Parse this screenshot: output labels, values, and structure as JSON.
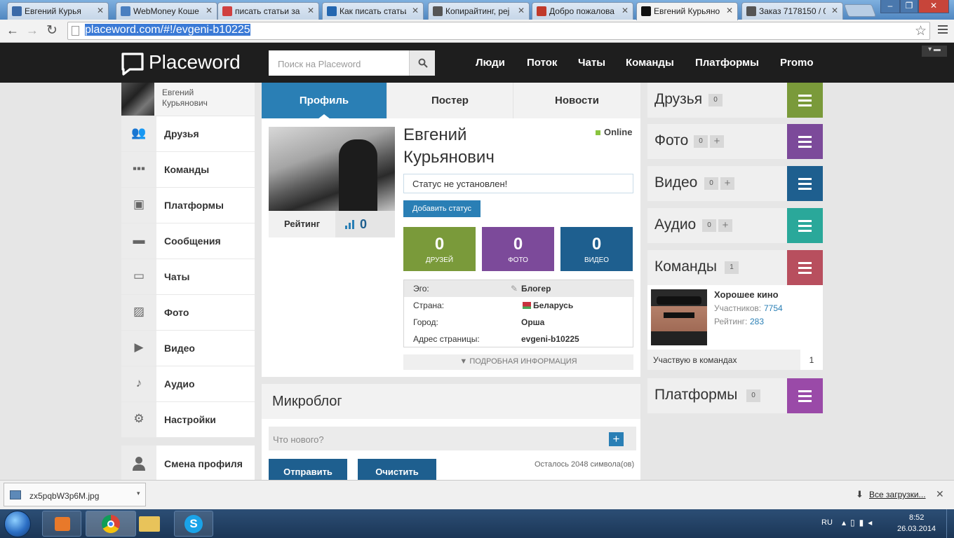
{
  "browser": {
    "tabs": [
      {
        "title": "Евгений Курья",
        "favicon": "video-favicon",
        "color": "#3b6aa8"
      },
      {
        "title": "WebMoney Коше",
        "favicon": "webmoney-favicon",
        "color": "#4a7fc0"
      },
      {
        "title": "писать статьи за д",
        "favicon": "yandex-favicon",
        "color": "#d04040"
      },
      {
        "title": "Как писать статьи",
        "favicon": "bo-favicon",
        "color": "#2366b0"
      },
      {
        "title": "Копирайтинг, реј",
        "favicon": "a-favicon",
        "color": "#555555"
      },
      {
        "title": "Добро пожалова",
        "favicon": "gmail-favicon",
        "color": "#c03a2b"
      },
      {
        "title": "Евгений Курьяно",
        "favicon": "placeword-favicon",
        "color": "#111111"
      },
      {
        "title": "Заказ 7178150 / 0",
        "favicon": "a-favicon",
        "color": "#555555"
      }
    ],
    "url_selected": "placeword.com/#!/evgeni-b10225"
  },
  "header": {
    "logo": "Placeword",
    "search_placeholder": "Поиск на Placeword",
    "nav": [
      "Люди",
      "Поток",
      "Чаты",
      "Команды",
      "Платформы",
      "Promo"
    ]
  },
  "sidebar": {
    "user_name_line1": "Евгений",
    "user_name_line2": "Курьянович",
    "items": [
      {
        "label": "Друзья",
        "icon": "friends-icon"
      },
      {
        "label": "Команды",
        "icon": "teams-icon"
      },
      {
        "label": "Платформы",
        "icon": "platforms-icon"
      },
      {
        "label": "Сообщения",
        "icon": "messages-icon"
      },
      {
        "label": "Чаты",
        "icon": "chats-icon"
      },
      {
        "label": "Фото",
        "icon": "photo-icon"
      },
      {
        "label": "Видео",
        "icon": "video-icon"
      },
      {
        "label": "Аудио",
        "icon": "audio-icon"
      },
      {
        "label": "Настройки",
        "icon": "settings-icon"
      }
    ],
    "switch_profile": "Смена профиля"
  },
  "profile": {
    "tabs": [
      "Профиль",
      "Постер",
      "Новости"
    ],
    "name_line1": "Евгений",
    "name_line2": "Курьянович",
    "online": "Online",
    "status": "Статус не установлен!",
    "add_status": "Добавить статус",
    "rating_label": "Рейтинг",
    "rating_value": "0",
    "stats": [
      {
        "value": "0",
        "label": "ДРУЗЕЙ",
        "color": "#7a9a3a"
      },
      {
        "value": "0",
        "label": "ФОТО",
        "color": "#7c4a9a"
      },
      {
        "value": "0",
        "label": "ВИДЕО",
        "color": "#1e5f8f"
      }
    ],
    "info": [
      {
        "key": "Эго:",
        "value": "Блогер"
      },
      {
        "key": "Страна:",
        "value": "Беларусь"
      },
      {
        "key": "Город:",
        "value": "Орша"
      },
      {
        "key": "Адрес страницы:",
        "value": "evgeni-b10225"
      }
    ],
    "more_info": "ПОДРОБНАЯ ИНФОРМАЦИЯ"
  },
  "microblog": {
    "title": "Микроблог",
    "placeholder": "Что нового?",
    "send": "Отправить",
    "clear": "Очистить",
    "remaining": "Осталось 2048 символа(ов)"
  },
  "right": {
    "friends": {
      "title": "Друзья",
      "count": "0",
      "color": "#7a9a3a"
    },
    "photo": {
      "title": "Фото",
      "count": "0",
      "plus": "+",
      "color": "#7c4a9a"
    },
    "video": {
      "title": "Видео",
      "count": "0",
      "plus": "+",
      "color": "#1e5f8f"
    },
    "audio": {
      "title": "Аудио",
      "count": "0",
      "plus": "+",
      "color": "#2aa89a"
    },
    "teams": {
      "title": "Команды",
      "count": "1",
      "color": "#b84f5e"
    },
    "team_card": {
      "name": "Хорошее кино",
      "members_label": "Участников:",
      "members": "7754",
      "rating_label": "Рейтинг:",
      "rating": "283"
    },
    "participation_label": "Участвую в командах",
    "participation_count": "1",
    "platforms": {
      "title": "Платформы",
      "count": "0",
      "color": "#9a4aa8"
    }
  },
  "downloads": {
    "file": "zx5pqbW3p6M.jpg",
    "all": "Все загрузки..."
  },
  "taskbar": {
    "lang": "RU",
    "time": "8:52",
    "date": "26.03.2014"
  }
}
